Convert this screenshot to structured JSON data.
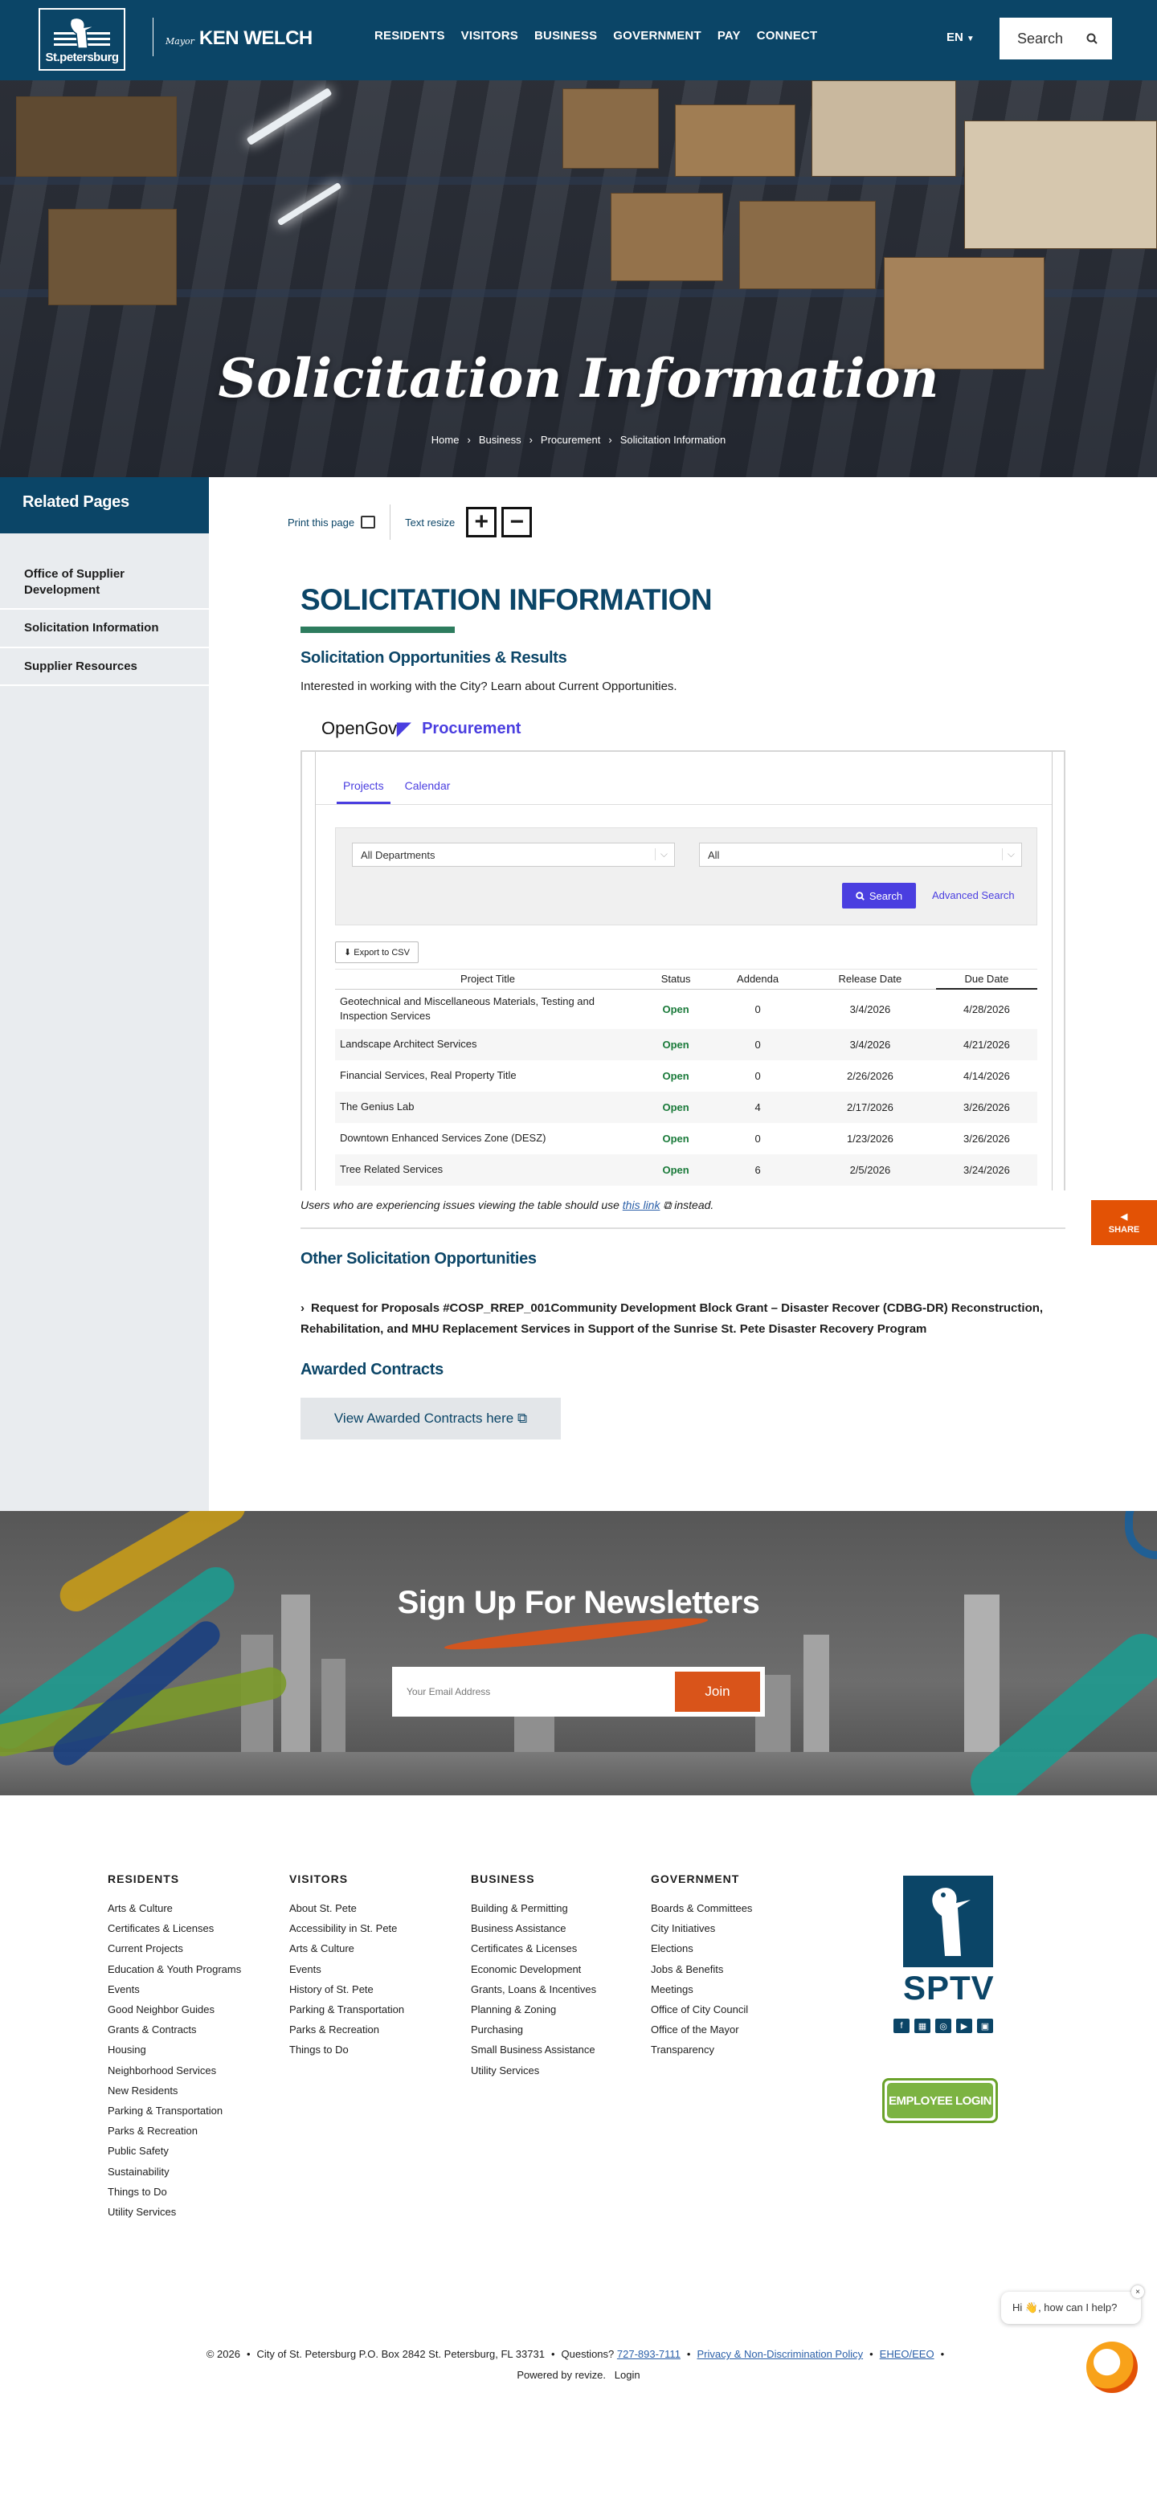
{
  "header": {
    "logo_text": "St.petersburg",
    "mayor_label": "Mayor",
    "mayor_name": "KEN WELCH",
    "nav": [
      "RESIDENTS",
      "VISITORS",
      "BUSINESS",
      "GOVERNMENT",
      "PAY",
      "CONNECT"
    ],
    "language": "EN",
    "search_label": "Search"
  },
  "hero": {
    "title": "Solicitation Information",
    "breadcrumb": [
      "Home",
      "Business",
      "Procurement",
      "Solicitation Information"
    ]
  },
  "sidebar": {
    "heading": "Related Pages",
    "items": [
      "Office of Supplier Development",
      "Solicitation Information",
      "Supplier Resources"
    ]
  },
  "tools": {
    "print": "Print this page",
    "text_resize": "Text resize",
    "plus": "+",
    "minus": "−"
  },
  "main": {
    "title": "SOLICITATION INFORMATION",
    "subheading": "Solicitation Opportunities & Results",
    "intro": "Interested in working with the City? Learn about Current Opportunities.",
    "note_before": "Users who are experiencing issues viewing the table should use ",
    "note_link": "this link",
    "note_after": " instead.",
    "other_heading": "Other Solicitation Opportunities",
    "rfp": "Request for Proposals #COSP_RREP_001Community Development Block Grant – Disaster Recover (CDBG-DR) Reconstruction, Rehabilitation, and MHU Replacement Services in Support of the Sunrise St. Pete Disaster Recovery Program",
    "awarded_heading": "Awarded Contracts",
    "awarded_button": "View Awarded Contracts here"
  },
  "opengov": {
    "logo": "OpenGov",
    "product": "Procurement",
    "tabs": [
      "Projects",
      "Calendar"
    ],
    "dept_select": "All Departments",
    "status_select": "All",
    "search_button": "Search",
    "advanced": "Advanced Search",
    "export": "Export to CSV",
    "columns": [
      "Project Title",
      "Status",
      "Addenda",
      "Release Date",
      "Due Date"
    ],
    "rows": [
      {
        "title": "Geotechnical and Miscellaneous Materials, Testing and Inspection Services",
        "status": "Open",
        "addenda": "0",
        "release": "3/4/2026",
        "due": "4/28/2026"
      },
      {
        "title": "Landscape Architect Services",
        "status": "Open",
        "addenda": "0",
        "release": "3/4/2026",
        "due": "4/21/2026"
      },
      {
        "title": "Financial Services, Real Property Title",
        "status": "Open",
        "addenda": "0",
        "release": "2/26/2026",
        "due": "4/14/2026"
      },
      {
        "title": "The Genius Lab",
        "status": "Open",
        "addenda": "4",
        "release": "2/17/2026",
        "due": "3/26/2026"
      },
      {
        "title": "Downtown Enhanced Services Zone (DESZ)",
        "status": "Open",
        "addenda": "0",
        "release": "1/23/2026",
        "due": "3/26/2026"
      },
      {
        "title": "Tree Related Services",
        "status": "Open",
        "addenda": "6",
        "release": "2/5/2026",
        "due": "3/24/2026"
      }
    ]
  },
  "share": "SHARE",
  "newsletter": {
    "title": "Sign Up For Newsletters",
    "placeholder": "Your Email Address",
    "button": "Join"
  },
  "footer": {
    "columns": [
      {
        "heading": "RESIDENTS",
        "links": [
          "Arts & Culture",
          "Certificates & Licenses",
          "Current Projects",
          "Education & Youth Programs",
          "Events",
          "Good Neighbor Guides",
          "Grants & Contracts",
          "Housing",
          "Neighborhood Services",
          "New Residents",
          "Parking & Transportation",
          "Parks & Recreation",
          "Public Safety",
          "Sustainability",
          "Things to Do",
          "Utility Services"
        ]
      },
      {
        "heading": "VISITORS",
        "links": [
          "About St. Pete",
          "Accessibility in St. Pete",
          "Arts & Culture",
          "Events",
          "History of St. Pete",
          "Parking & Transportation",
          "Parks & Recreation",
          "Things to Do"
        ]
      },
      {
        "heading": "BUSINESS",
        "links": [
          "Building & Permitting",
          "Business Assistance",
          "Certificates & Licenses",
          "Economic Development",
          "Grants, Loans & Incentives",
          "Planning & Zoning",
          "Purchasing",
          "Small Business Assistance",
          "Utility Services"
        ]
      },
      {
        "heading": "GOVERNMENT",
        "links": [
          "Boards & Committees",
          "City Initiatives",
          "Elections",
          "Jobs & Benefits",
          "Meetings",
          "Office of City Council",
          "Office of the Mayor",
          "Transparency"
        ]
      }
    ],
    "sptv": "SPTV",
    "employee_login": "EMPLOYEE LOGIN",
    "copyright": "© 2026",
    "address": "City of St. Petersburg P.O. Box 2842 St. Petersburg, FL 33731",
    "questions": "Questions?",
    "phone": "727-893-7111",
    "privacy": "Privacy & Non-Discrimination Policy",
    "eeo": "EHEO/EEO",
    "powered": "Powered by revize.",
    "login": "Login"
  },
  "chat": {
    "greeting": "Hi 👋, how can I help?",
    "close": "×"
  },
  "colors": {
    "brand_navy": "#0b4567",
    "accent_green": "#2d7c5e",
    "opengov_purple": "#4a3ee0",
    "accent_orange": "#e35205"
  }
}
